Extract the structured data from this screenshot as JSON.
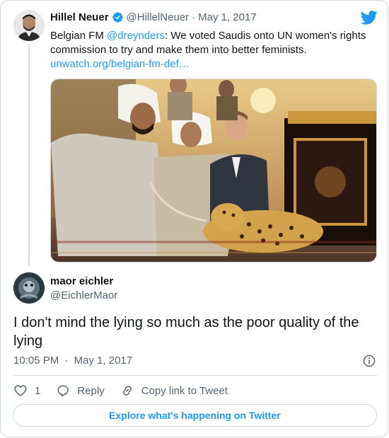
{
  "tweet1": {
    "author_name": "Hillel Neuer",
    "handle": "@HillelNeuer",
    "date": "May 1, 2017",
    "text_prefix": "Belgian FM ",
    "mention": "@dreynders",
    "text_suffix": ": We voted Saudis onto UN women's rights commission to try and make them into better feminists.",
    "link_text": "unwatch.org/belgian-fm-def…"
  },
  "tweet2": {
    "author_name": "maor eichler",
    "handle": "@EichlerMaor",
    "text": "I don't mind the lying so much as the poor quality of the lying",
    "time": "10:05 PM",
    "date": "May 1, 2017"
  },
  "actions": {
    "like_count": "1",
    "reply_label": "Reply",
    "copy_link_label": "Copy link to Tweet"
  },
  "explore_label": "Explore what's happening on Twitter",
  "separator": "·",
  "icons": {
    "verified": "verified-badge-icon",
    "twitter": "twitter-bird-icon",
    "info": "info-icon",
    "heart": "heart-icon",
    "reply": "reply-icon",
    "link": "link-icon"
  },
  "colors": {
    "accent": "#1d9bf0",
    "secondary_text": "#536471",
    "border": "#cfd9de"
  }
}
